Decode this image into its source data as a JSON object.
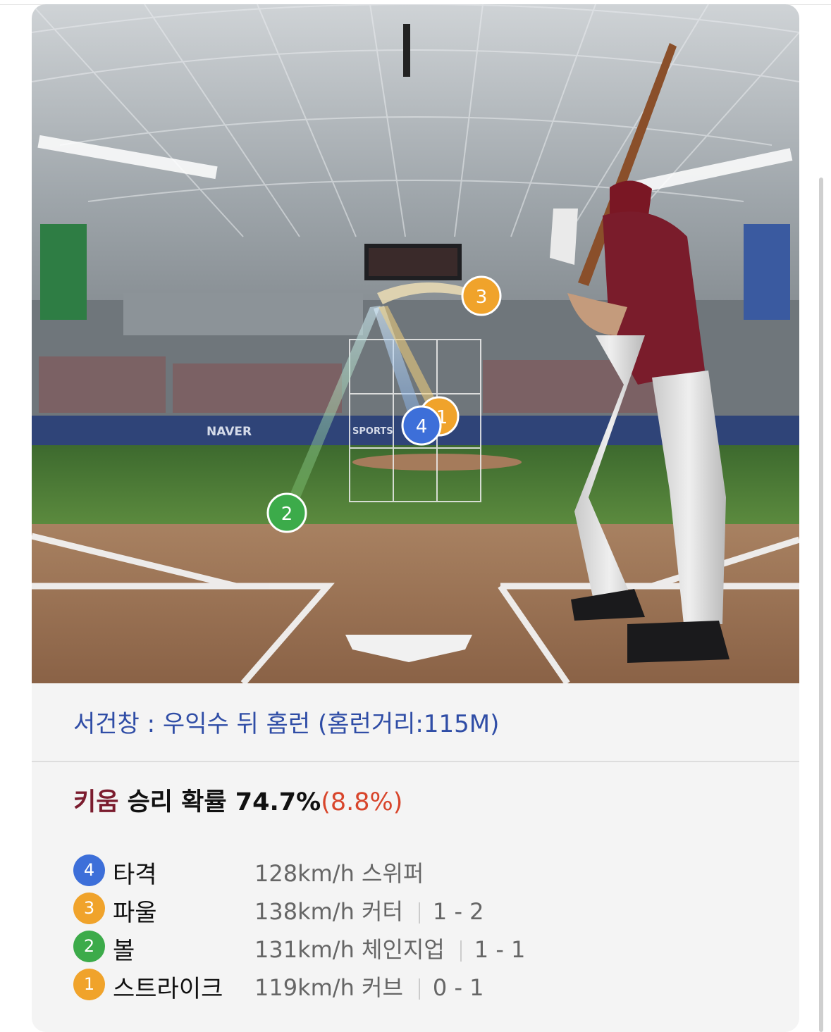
{
  "scene": {
    "banner_brand": "NAVER",
    "banner_sports": "SPORTS",
    "markers": [
      {
        "number": "3",
        "color": "#f0a32b"
      },
      {
        "number": "1",
        "color": "#f0a32b"
      },
      {
        "number": "4",
        "color": "#3d6fd9"
      },
      {
        "number": "2",
        "color": "#3cab4a"
      }
    ]
  },
  "play": {
    "caption": "서건창 : 우익수 뒤 홈런 (홈런거리:115M)"
  },
  "win_probability": {
    "team": "키움",
    "label": "승리 확률",
    "value": "74.7%",
    "delta": "(8.8%)"
  },
  "pitches": [
    {
      "number": "4",
      "result": "타격",
      "speed": "128km/h",
      "pitch_type": "스위퍼",
      "count": "",
      "color": "#3d6fd9"
    },
    {
      "number": "3",
      "result": "파울",
      "speed": "138km/h",
      "pitch_type": "커터",
      "count": "1 - 2",
      "color": "#f0a32b"
    },
    {
      "number": "2",
      "result": "볼",
      "speed": "131km/h",
      "pitch_type": "체인지업",
      "count": "1 - 1",
      "color": "#3cab4a"
    },
    {
      "number": "1",
      "result": "스트라이크",
      "speed": "119km/h",
      "pitch_type": "커브",
      "count": "0 - 1",
      "color": "#f0a32b"
    }
  ]
}
